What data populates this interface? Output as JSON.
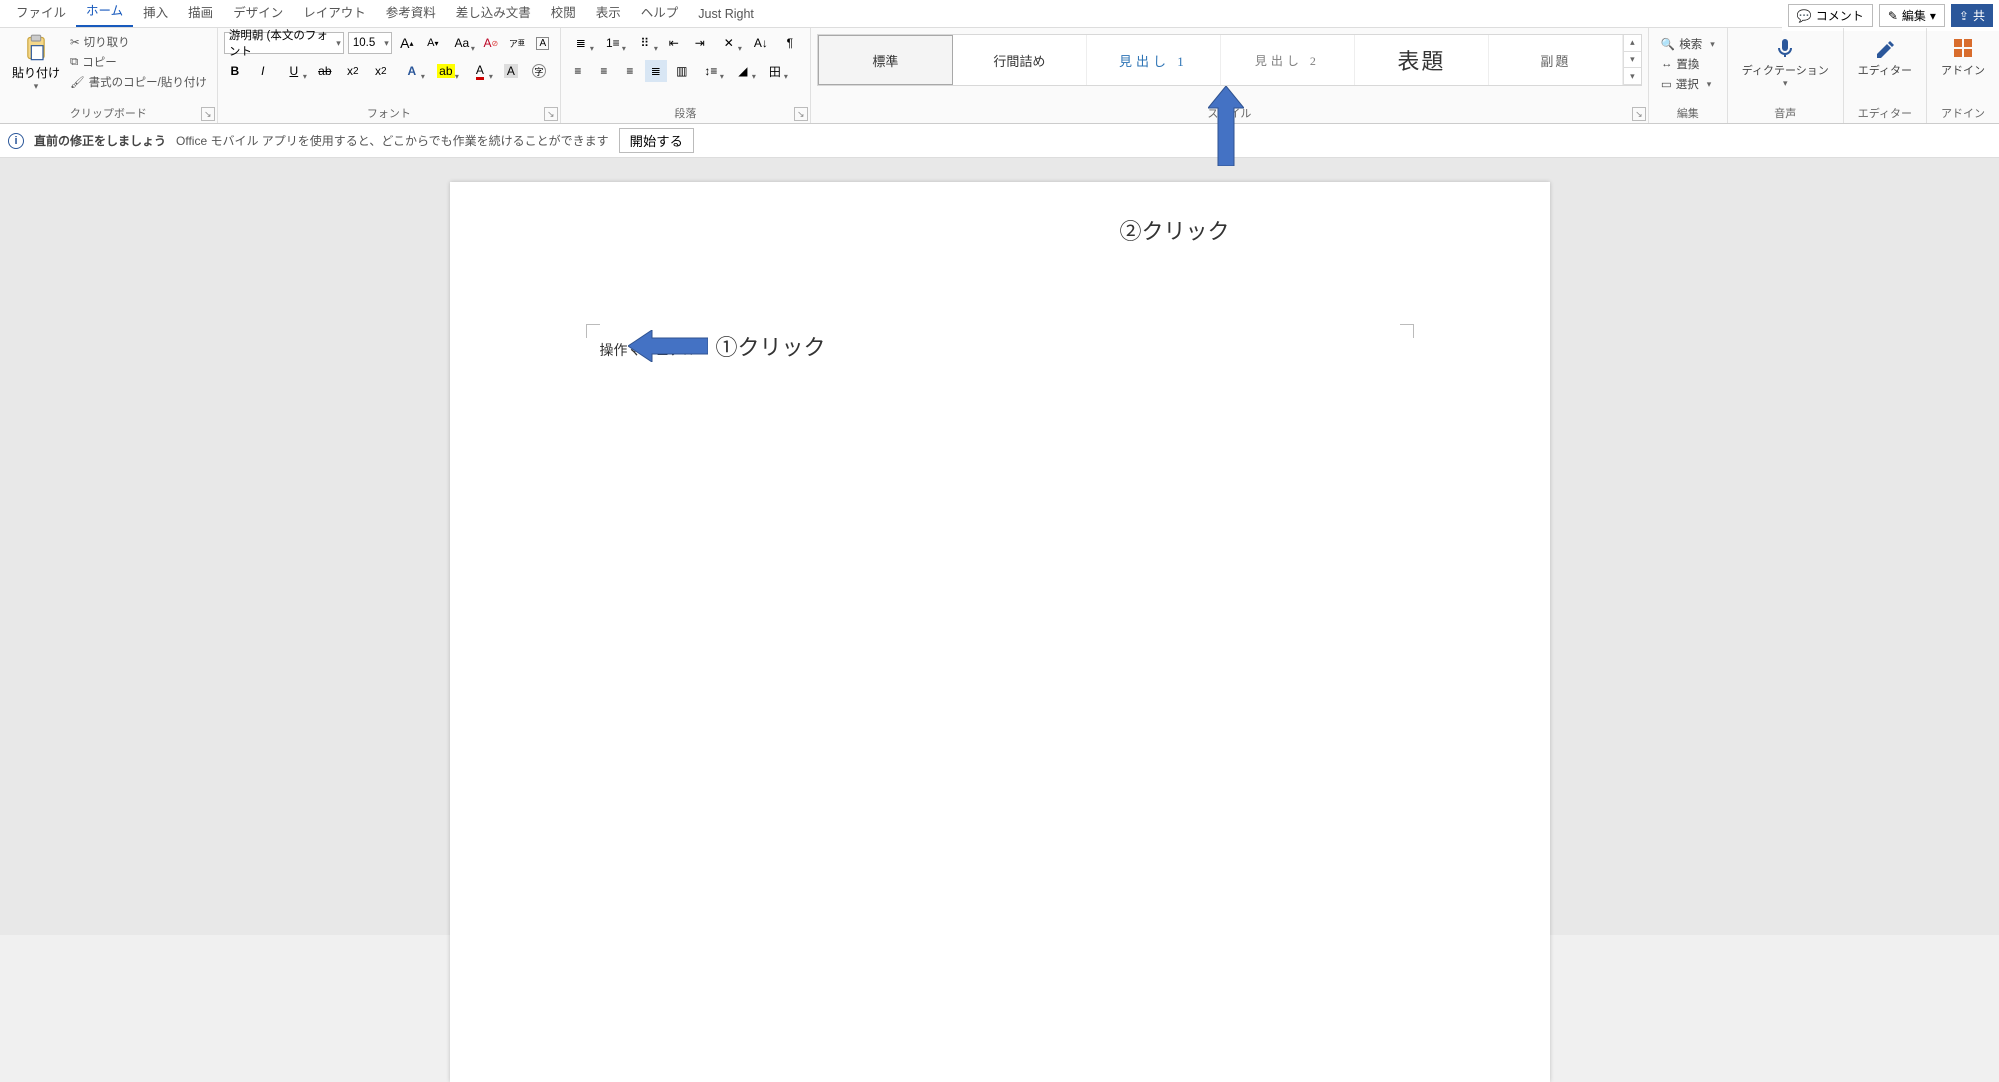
{
  "tabs": {
    "file": "ファイル",
    "home": "ホーム",
    "insert": "挿入",
    "draw": "描画",
    "design": "デザイン",
    "layout": "レイアウト",
    "references": "参考資料",
    "mailings": "差し込み文書",
    "review": "校閲",
    "view": "表示",
    "help": "ヘルプ",
    "justright": "Just Right"
  },
  "topright": {
    "comment": "コメント",
    "edit": "編集",
    "share": "共"
  },
  "clipboard": {
    "paste": "貼り付け",
    "cut": "切り取り",
    "copy": "コピー",
    "format_painter": "書式のコピー/貼り付け",
    "label": "クリップボード"
  },
  "font": {
    "name": "游明朝 (本文のフォント",
    "size": "10.5",
    "label": "フォント"
  },
  "paragraph": {
    "label": "段落"
  },
  "styles": {
    "normal": "標準",
    "no_spacing": "行間詰め",
    "heading1": "見出し 1",
    "heading2": "見出し 2",
    "title": "表題",
    "subtitle": "副題",
    "label": "スタイル"
  },
  "editing": {
    "find": "検索",
    "replace": "置換",
    "select": "選択",
    "label": "編集"
  },
  "voice": {
    "dictate": "ディクテーション",
    "label": "音声"
  },
  "editor": {
    "editor": "エディター",
    "label": "エディター"
  },
  "addin": {
    "addin": "アドイン",
    "label": "アドイン"
  },
  "infobar": {
    "title": "直前の修正をしましょう",
    "desc": "Office モバイル アプリを使用すると、どこからでも作業を続けることができます",
    "start": "開始する"
  },
  "document": {
    "text": "操作マニュアル"
  },
  "annotations": {
    "click1": "①クリック",
    "click2": "②クリック"
  }
}
